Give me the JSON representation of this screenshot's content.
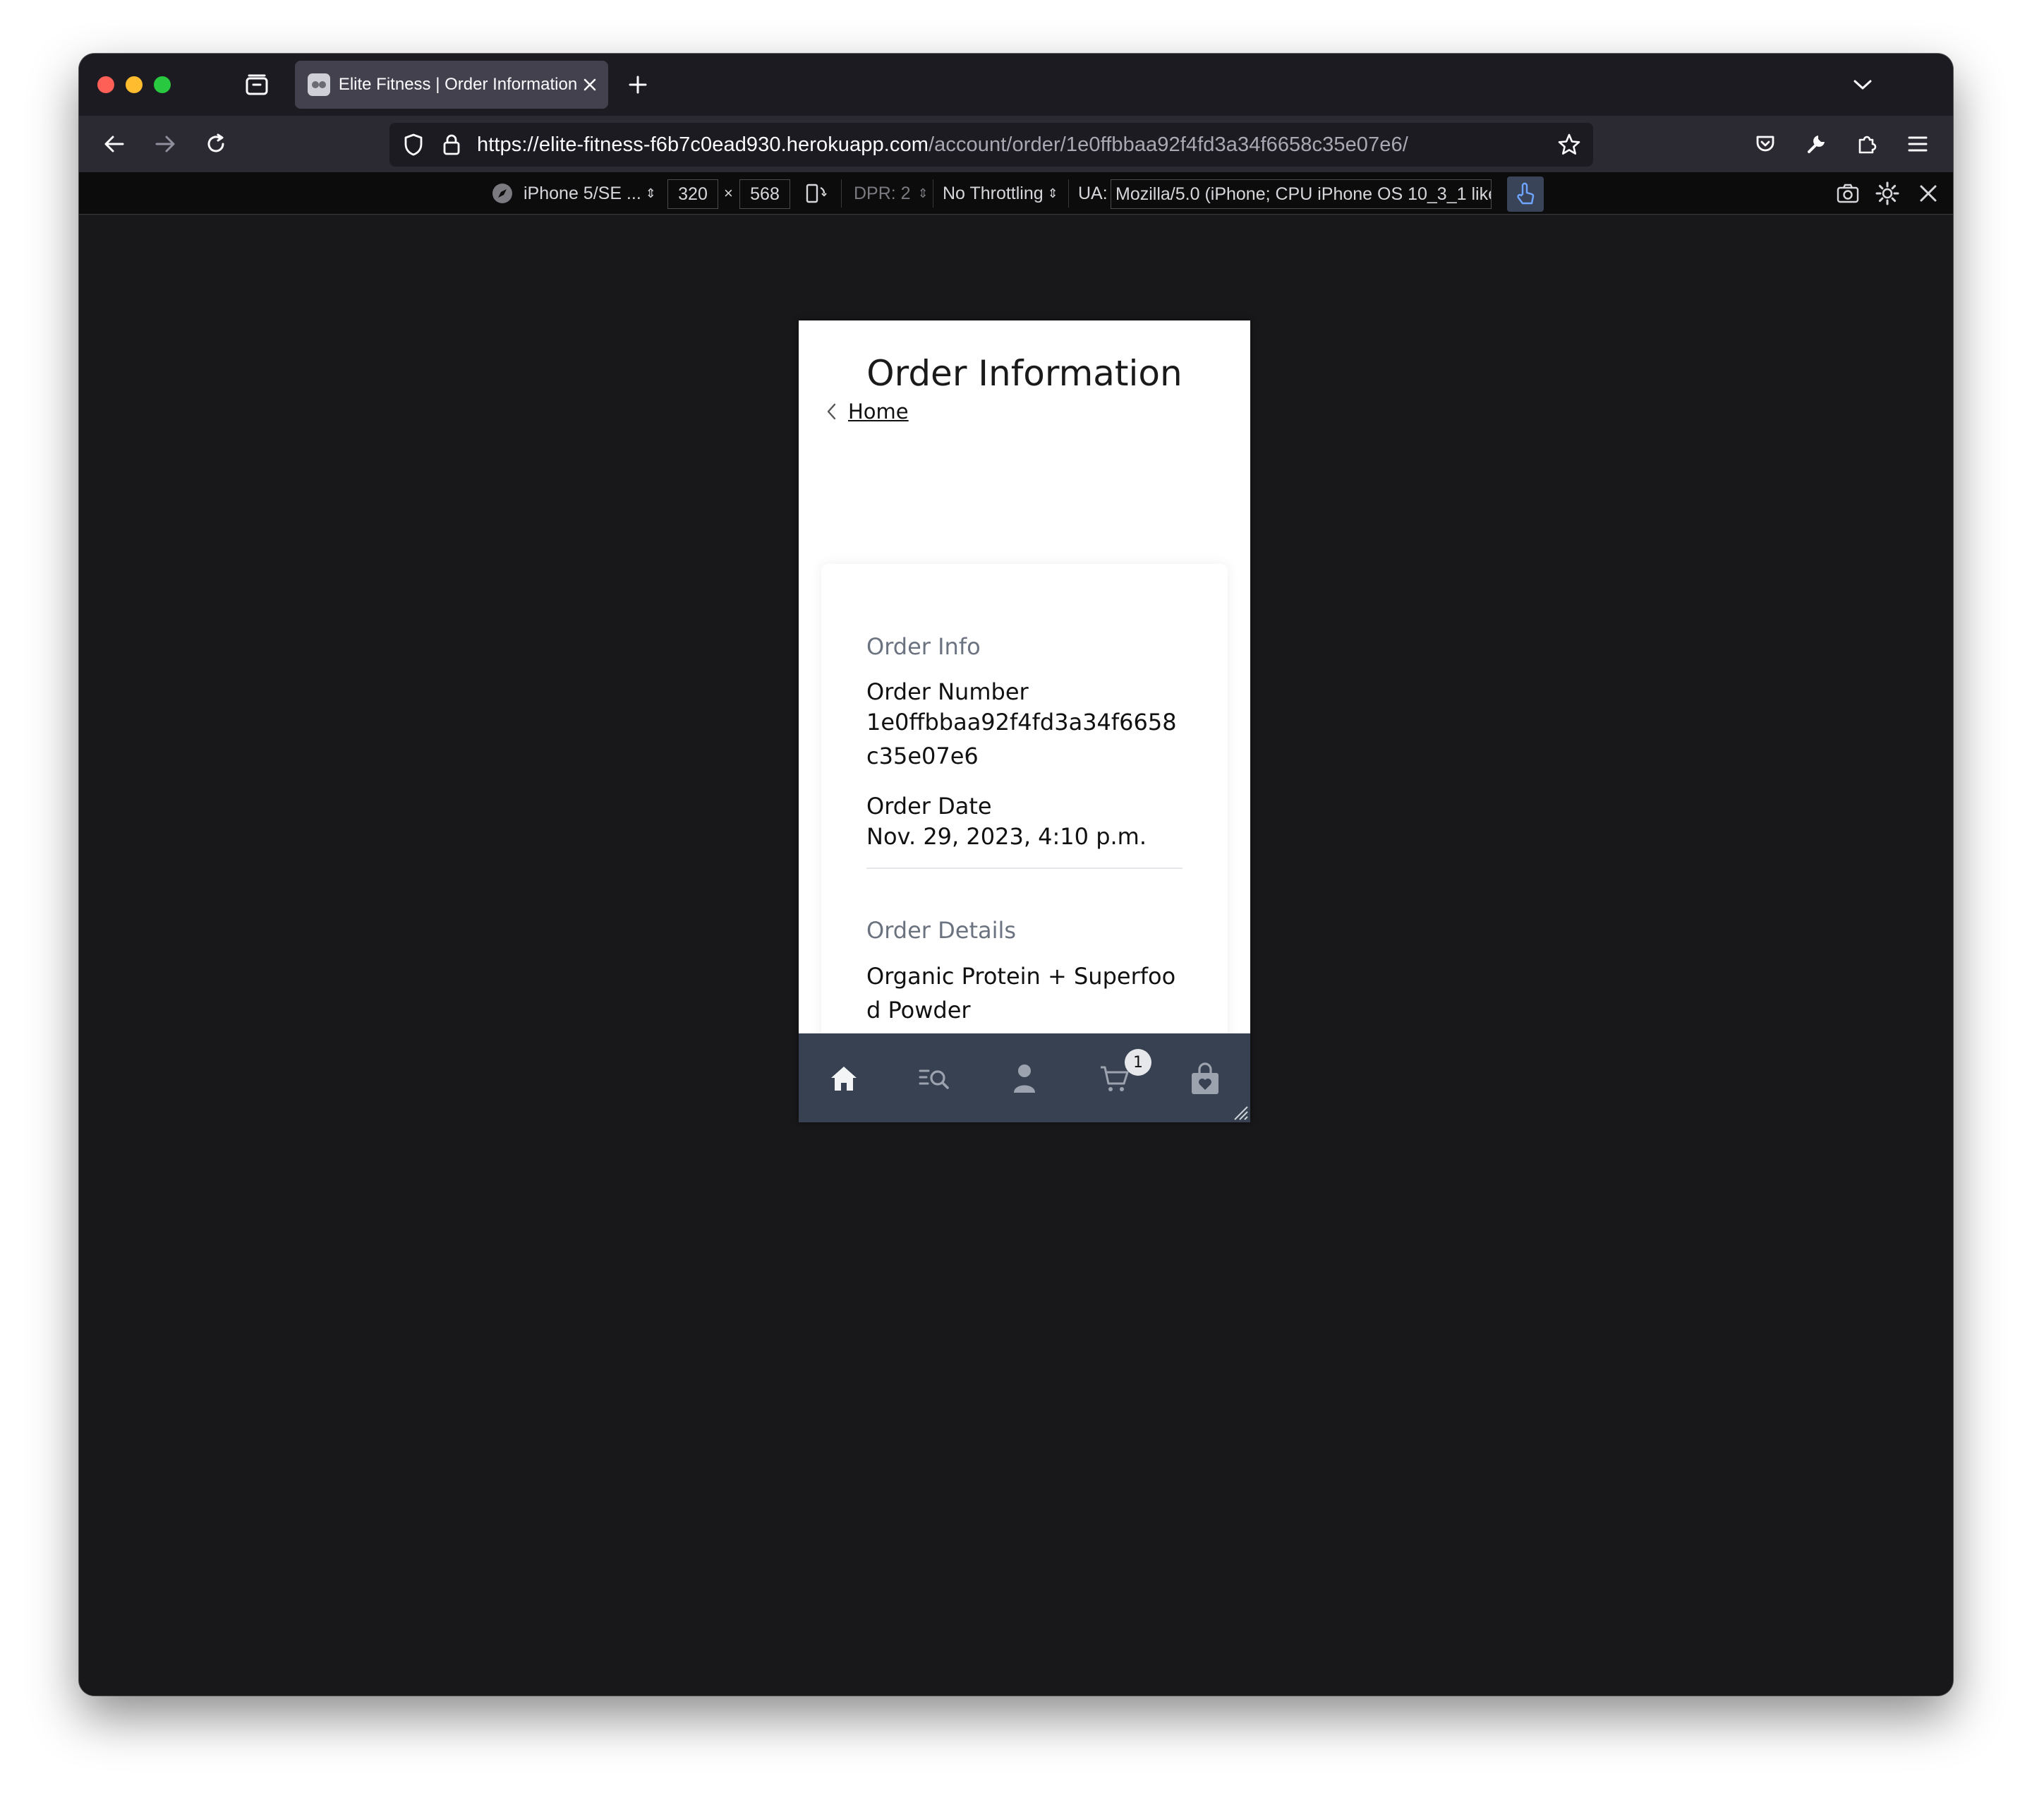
{
  "browser": {
    "tab_title": "Elite Fitness | Order Information",
    "url_host": "https://elite-fitness-f6b7c0ead930.herokuapp.com",
    "url_path": "/account/order/1e0ffbbaa92f4fd3a34f6658c35e07e6/"
  },
  "rdm": {
    "device": "iPhone 5/SE ...",
    "width": "320",
    "times": "×",
    "height": "568",
    "dpr": "DPR: 2",
    "throttling": "No Throttling",
    "ua_label": "UA:",
    "ua_value": "Mozilla/5.0 (iPhone; CPU iPhone OS 10_3_1 like"
  },
  "page": {
    "title": "Order Information",
    "back_label": "Home",
    "order_info": {
      "heading": "Order Info",
      "number_label": "Order Number",
      "number_value": "1e0ffbbaa92f4fd3a34f6658c35e07e6",
      "date_label": "Order Date",
      "date_value": "Nov. 29, 2023, 4:10 p.m."
    },
    "order_details": {
      "heading": "Order Details",
      "product": "Organic Protein + Superfood Powder"
    },
    "bottom_nav": {
      "items": [
        "home-icon",
        "search-list-icon",
        "account-icon",
        "cart-icon",
        "shopping-bag-icon"
      ],
      "cart_count": "1"
    }
  },
  "colors": {
    "bottom_nav_bg": "#374151",
    "section_heading": "#6b7280",
    "touch_active": "#3a4459"
  }
}
